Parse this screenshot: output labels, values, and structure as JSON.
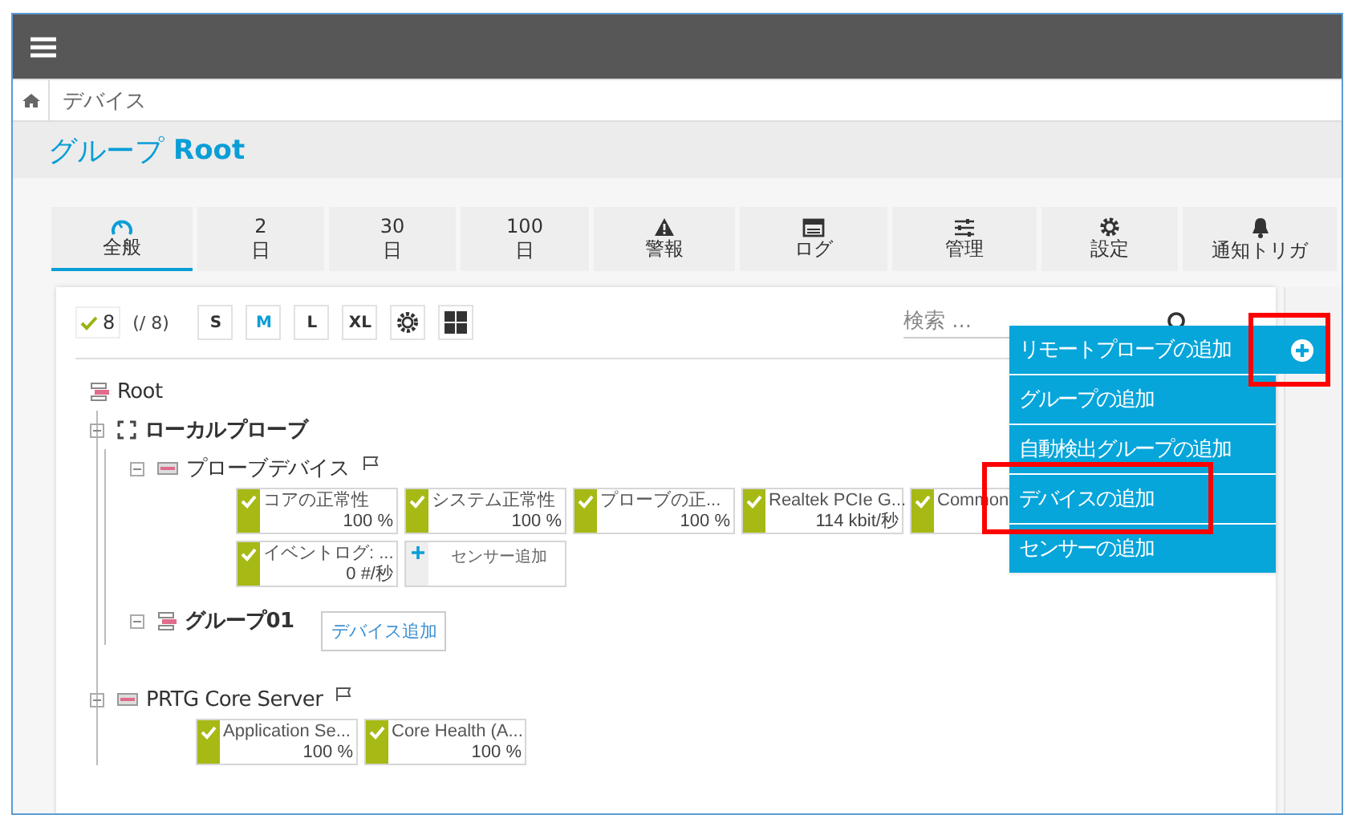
{
  "breadcrumb": {
    "label": "デバイス"
  },
  "page_title": {
    "prefix": "グループ",
    "name": "Root"
  },
  "tabs": [
    {
      "kind": "gauge",
      "label": "全般",
      "selected": true
    },
    {
      "kind": "number",
      "number": "2",
      "label": "日",
      "selected": false
    },
    {
      "kind": "number",
      "number": "30",
      "label": "日",
      "selected": false
    },
    {
      "kind": "number",
      "number": "100",
      "label": "日",
      "selected": false
    },
    {
      "kind": "alert",
      "label": "警報",
      "selected": false
    },
    {
      "kind": "log",
      "label": "ログ",
      "selected": false
    },
    {
      "kind": "sliders",
      "label": "管理",
      "selected": false
    },
    {
      "kind": "gear",
      "label": "設定",
      "selected": false
    },
    {
      "kind": "bell",
      "label": "通知トリガ",
      "selected": false
    }
  ],
  "toolbar": {
    "ok_count": "8",
    "total": "(/ 8)",
    "sizes": [
      {
        "label": "S",
        "selected": false
      },
      {
        "label": "M",
        "selected": true
      },
      {
        "label": "L",
        "selected": false
      },
      {
        "label": "XL",
        "selected": false
      }
    ]
  },
  "search": {
    "placeholder": "検索 ..."
  },
  "tree": [
    {
      "kind": "root",
      "name": "Root",
      "children": [
        {
          "kind": "probe",
          "name": "ローカルプローブ",
          "expanded": true,
          "flagged": false,
          "children": [
            {
              "kind": "device",
              "name": "プローブデバイス",
              "expanded": true,
              "flagged": true,
              "sensors": [
                {
                  "kind": "sensor",
                  "name": "コアの正常性",
                  "value": "100 %"
                },
                {
                  "kind": "sensor",
                  "name": "システム正常性",
                  "value": "100 %"
                },
                {
                  "kind": "sensor",
                  "name": "プローブの正...",
                  "value": "100 %"
                },
                {
                  "kind": "sensor",
                  "name": "Realtek PCIe G...",
                  "value": "114 kbit/秒"
                },
                {
                  "kind": "sensor",
                  "name": "Common"
                },
                {
                  "kind": "sensor",
                  "name": "イベントログ: ...",
                  "value": "0 #/秒"
                },
                {
                  "kind": "add",
                  "name": "センサー追加"
                }
              ]
            },
            {
              "kind": "group",
              "name": "グループ01",
              "expanded": true,
              "flagged": false,
              "add_device": "デバイス追加"
            }
          ]
        },
        {
          "kind": "device",
          "name": "PRTG Core Server",
          "expanded": true,
          "flagged": true,
          "sensors": [
            {
              "kind": "sensor",
              "name": "Application Se...",
              "value": "100 %"
            },
            {
              "kind": "sensor",
              "name": "Core Health (A...",
              "value": "100 %"
            }
          ]
        }
      ]
    }
  ],
  "add_button": {
    "highlighted": true
  },
  "add_menu": [
    {
      "label": "リモートプローブの追加",
      "highlighted": false
    },
    {
      "label": "グループの追加",
      "highlighted": false
    },
    {
      "label": "自動検出グループの追加",
      "highlighted": false
    },
    {
      "label": "デバイスの追加",
      "highlighted": true
    },
    {
      "label": "センサーの追加",
      "highlighted": false
    }
  ]
}
